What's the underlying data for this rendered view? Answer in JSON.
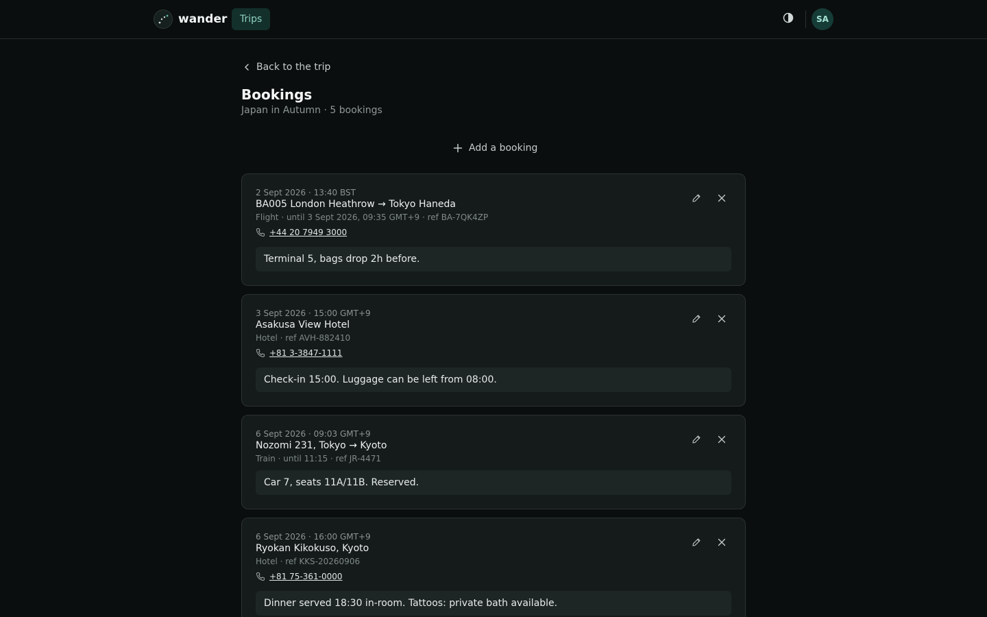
{
  "app": {
    "name": "wander",
    "nav_tab": "Trips",
    "avatar_initials": "SA"
  },
  "back_link": "Back to the trip",
  "page": {
    "title": "Bookings",
    "subtitle": "Japan in Autumn · 5 bookings"
  },
  "add_booking_label": "Add a booking",
  "bookings": [
    {
      "when": "2 Sept 2026 · 13:40 BST",
      "title": "BA005 London Heathrow → Tokyo Haneda",
      "meta": "Flight · until 3 Sept 2026, 09:35 GMT+9 · ref BA-7QK4ZP",
      "phone": "+44 20 7949 3000",
      "note": "Terminal 5, bags drop 2h before."
    },
    {
      "when": "3 Sept 2026 · 15:00 GMT+9",
      "title": "Asakusa View Hotel",
      "meta": "Hotel · ref AVH-882410",
      "phone": "+81 3-3847-1111",
      "note": "Check-in 15:00. Luggage can be left from 08:00."
    },
    {
      "when": "6 Sept 2026 · 09:03 GMT+9",
      "title": "Nozomi 231, Tokyo → Kyoto",
      "meta": "Train · until 11:15 · ref JR-4471",
      "phone": "",
      "note": "Car 7, seats 11A/11B. Reserved."
    },
    {
      "when": "6 Sept 2026 · 16:00 GMT+9",
      "title": "Ryokan Kikokuso, Kyoto",
      "meta": "Hotel · ref KKS-20260906",
      "phone": "+81 75-361-0000",
      "note": "Dinner served 18:30 in-room. Tattoos: private bath available."
    }
  ],
  "icons": {
    "logo": "trail-dots-icon",
    "theme": "contrast-icon",
    "back": "chevron-left-icon",
    "add": "plus-icon",
    "phone": "phone-icon",
    "edit": "pencil-icon",
    "delete": "close-icon"
  },
  "colors": {
    "accent": "#8fd1c2",
    "accent_bg": "#13302b",
    "background": "#0b0e0e",
    "card": "#151a1a"
  }
}
